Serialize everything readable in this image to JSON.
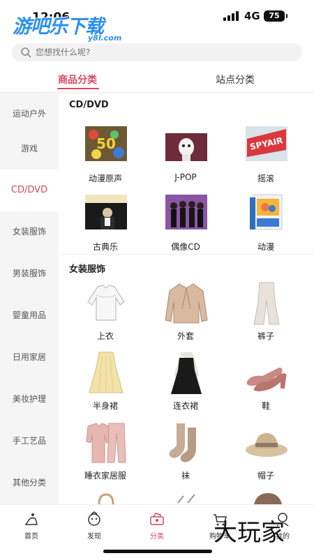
{
  "status_bar": {
    "time": "12:06",
    "network": "4G",
    "battery": "75"
  },
  "watermark": {
    "top_text": "游吧乐下载",
    "top_sub": "y8l.com",
    "bottom_text": "大玩家"
  },
  "search": {
    "placeholder": "您想找什么呢?"
  },
  "tabs": [
    {
      "label": "商品分类",
      "active": true
    },
    {
      "label": "站点分类",
      "active": false
    }
  ],
  "sidebar": {
    "items": [
      {
        "label": "运动户外"
      },
      {
        "label": "游戏"
      },
      {
        "label": "CD/DVD",
        "active": true
      },
      {
        "label": "女装服饰"
      },
      {
        "label": "男装服饰"
      },
      {
        "label": "婴童用品"
      },
      {
        "label": "日用家居"
      },
      {
        "label": "美妆护理"
      },
      {
        "label": "手工艺品"
      },
      {
        "label": "其他分类"
      }
    ]
  },
  "sections": [
    {
      "title": "CD/DVD",
      "items": [
        {
          "label": "动漫原声",
          "icon": "anime-cd-cover"
        },
        {
          "label": "J-POP",
          "icon": "jpop-cd-cover"
        },
        {
          "label": "摇滚",
          "icon": "rock-cd-cover"
        },
        {
          "label": "古典乐",
          "icon": "classical-cd-cover"
        },
        {
          "label": "偶像CD",
          "icon": "idol-cd-cover"
        },
        {
          "label": "动漫",
          "icon": "anime-dvd-box"
        }
      ]
    },
    {
      "title": "女装服饰",
      "items": [
        {
          "label": "上衣",
          "icon": "white-blouse"
        },
        {
          "label": "外套",
          "icon": "beige-jacket"
        },
        {
          "label": "裤子",
          "icon": "flared-pants"
        },
        {
          "label": "半身裙",
          "icon": "yellow-skirt"
        },
        {
          "label": "连衣裙",
          "icon": "black-dress"
        },
        {
          "label": "鞋",
          "icon": "pink-heels"
        },
        {
          "label": "睡衣家居服",
          "icon": "pink-pajamas"
        },
        {
          "label": "袜",
          "icon": "knit-socks"
        },
        {
          "label": "帽子",
          "icon": "straw-hat"
        }
      ]
    }
  ],
  "bottom_nav": [
    {
      "label": "首页",
      "icon": "home-icon"
    },
    {
      "label": "发现",
      "icon": "discover-icon"
    },
    {
      "label": "分类",
      "icon": "category-icon",
      "active": true
    },
    {
      "label": "购物车",
      "icon": "cart-icon"
    },
    {
      "label": "我的",
      "icon": "profile-icon"
    }
  ],
  "colors": {
    "accent": "#d6485f",
    "sidebar_bg": "#f5f5f5",
    "watermark_blue": "#2a8ff0"
  }
}
